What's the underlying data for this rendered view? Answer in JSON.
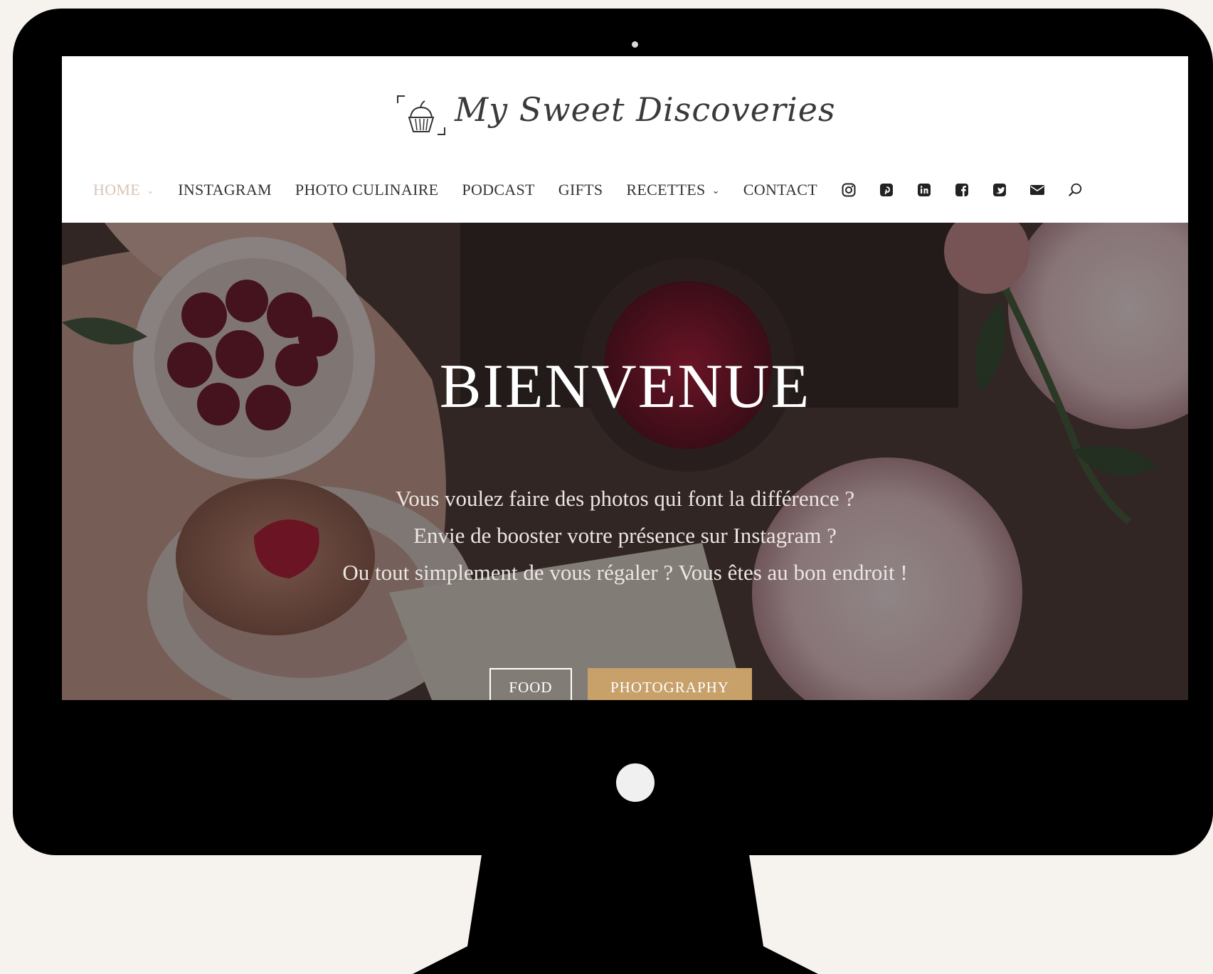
{
  "site": {
    "logo_text": "My Sweet Discoveries"
  },
  "nav": {
    "items": [
      {
        "label": "HOME",
        "has_dropdown": true,
        "active": true
      },
      {
        "label": "INSTAGRAM",
        "has_dropdown": false
      },
      {
        "label": "PHOTO CULINAIRE",
        "has_dropdown": false
      },
      {
        "label": "PODCAST",
        "has_dropdown": false
      },
      {
        "label": "GIFTS",
        "has_dropdown": false
      },
      {
        "label": "RECETTES",
        "has_dropdown": true
      },
      {
        "label": "CONTACT",
        "has_dropdown": false
      }
    ],
    "chevron": "⌄",
    "social_icons": [
      "instagram-icon",
      "pinterest-icon",
      "linkedin-icon",
      "facebook-icon",
      "twitter-icon",
      "email-icon",
      "search-icon"
    ]
  },
  "hero": {
    "title": "BIENVENUE",
    "lines": [
      "Vous voulez faire des photos qui font la différence ?",
      "Envie de booster votre présence sur Instagram ?",
      "Ou tout simplement de vous régaler ? Vous êtes au bon endroit !"
    ],
    "button_food": "FOOD",
    "button_photography": "PHOTOGRAPHY"
  },
  "colors": {
    "active_nav": "#d9c4b6",
    "accent_button": "#c7a06a",
    "page_background": "#f6f3ee"
  }
}
